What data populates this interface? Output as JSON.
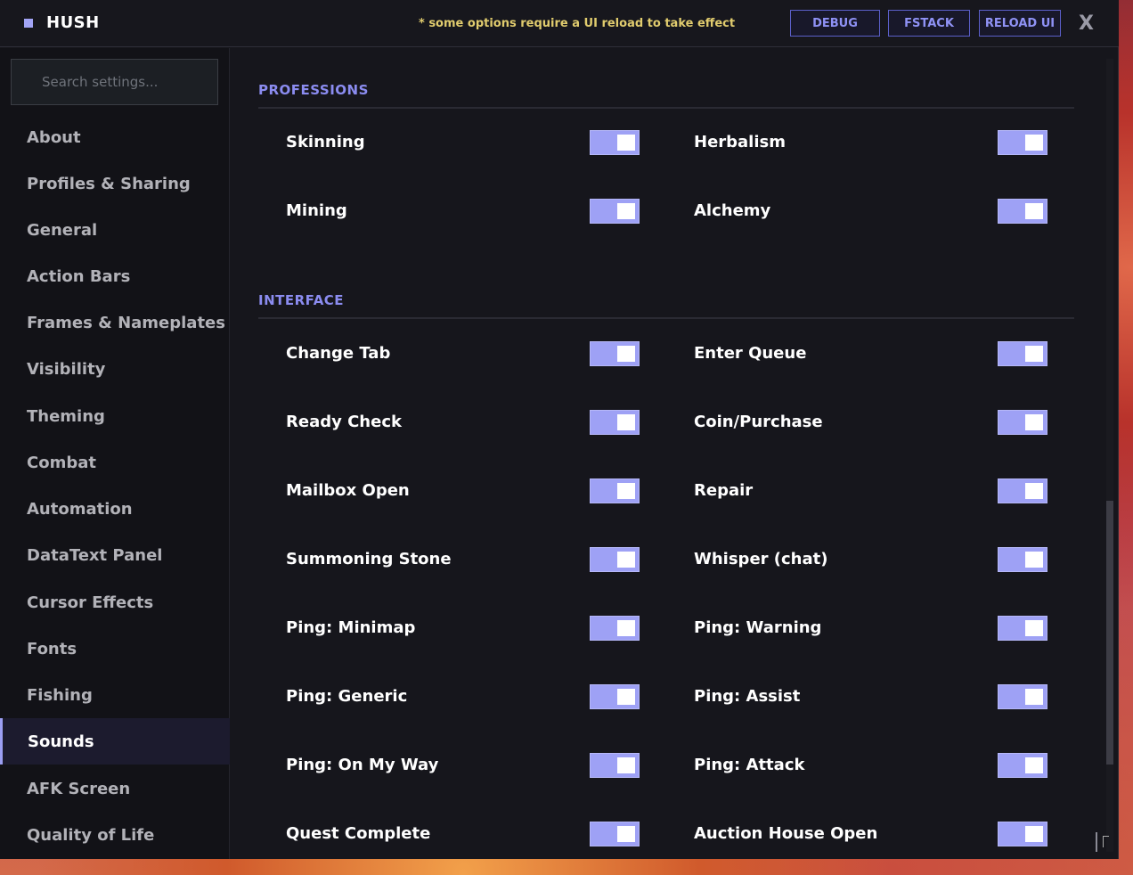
{
  "app": {
    "title": "HUSH"
  },
  "notice": "* some options require a UI reload to take effect",
  "toolbar": {
    "debug": "DEBUG",
    "fstack": "FSTACK",
    "reload": "RELOAD UI",
    "close": "X"
  },
  "search": {
    "placeholder": "Search settings..."
  },
  "sidebar": {
    "items": [
      {
        "label": "About"
      },
      {
        "label": "Profiles & Sharing"
      },
      {
        "label": "General"
      },
      {
        "label": "Action Bars"
      },
      {
        "label": "Frames & Nameplates"
      },
      {
        "label": "Visibility"
      },
      {
        "label": "Theming"
      },
      {
        "label": "Combat"
      },
      {
        "label": "Automation"
      },
      {
        "label": "DataText Panel"
      },
      {
        "label": "Cursor Effects"
      },
      {
        "label": "Fonts"
      },
      {
        "label": "Fishing"
      },
      {
        "label": "Sounds"
      },
      {
        "label": "AFK Screen"
      },
      {
        "label": "Quality of Life"
      }
    ],
    "active": "Sounds"
  },
  "sections": [
    {
      "title": "PROFESSIONS",
      "options": [
        {
          "label": "Skinning",
          "enabled": true
        },
        {
          "label": "Herbalism",
          "enabled": true
        },
        {
          "label": "Mining",
          "enabled": true
        },
        {
          "label": "Alchemy",
          "enabled": true
        }
      ]
    },
    {
      "title": "INTERFACE",
      "options": [
        {
          "label": "Change Tab",
          "enabled": true
        },
        {
          "label": "Enter Queue",
          "enabled": true
        },
        {
          "label": "Ready Check",
          "enabled": true
        },
        {
          "label": "Coin/Purchase",
          "enabled": true
        },
        {
          "label": "Mailbox Open",
          "enabled": true
        },
        {
          "label": "Repair",
          "enabled": true
        },
        {
          "label": "Summoning Stone",
          "enabled": true
        },
        {
          "label": "Whisper (chat)",
          "enabled": true
        },
        {
          "label": "Ping: Minimap",
          "enabled": true
        },
        {
          "label": "Ping: Warning",
          "enabled": true
        },
        {
          "label": "Ping: Generic",
          "enabled": true
        },
        {
          "label": "Ping: Assist",
          "enabled": true
        },
        {
          "label": "Ping: On My Way",
          "enabled": true
        },
        {
          "label": "Ping: Attack",
          "enabled": true
        },
        {
          "label": "Quest Complete",
          "enabled": true
        },
        {
          "label": "Auction House Open",
          "enabled": true
        }
      ]
    }
  ],
  "colors": {
    "accent": "#9ea1f5",
    "section_title": "#8b8cf0",
    "notice": "#e1cc6e"
  }
}
